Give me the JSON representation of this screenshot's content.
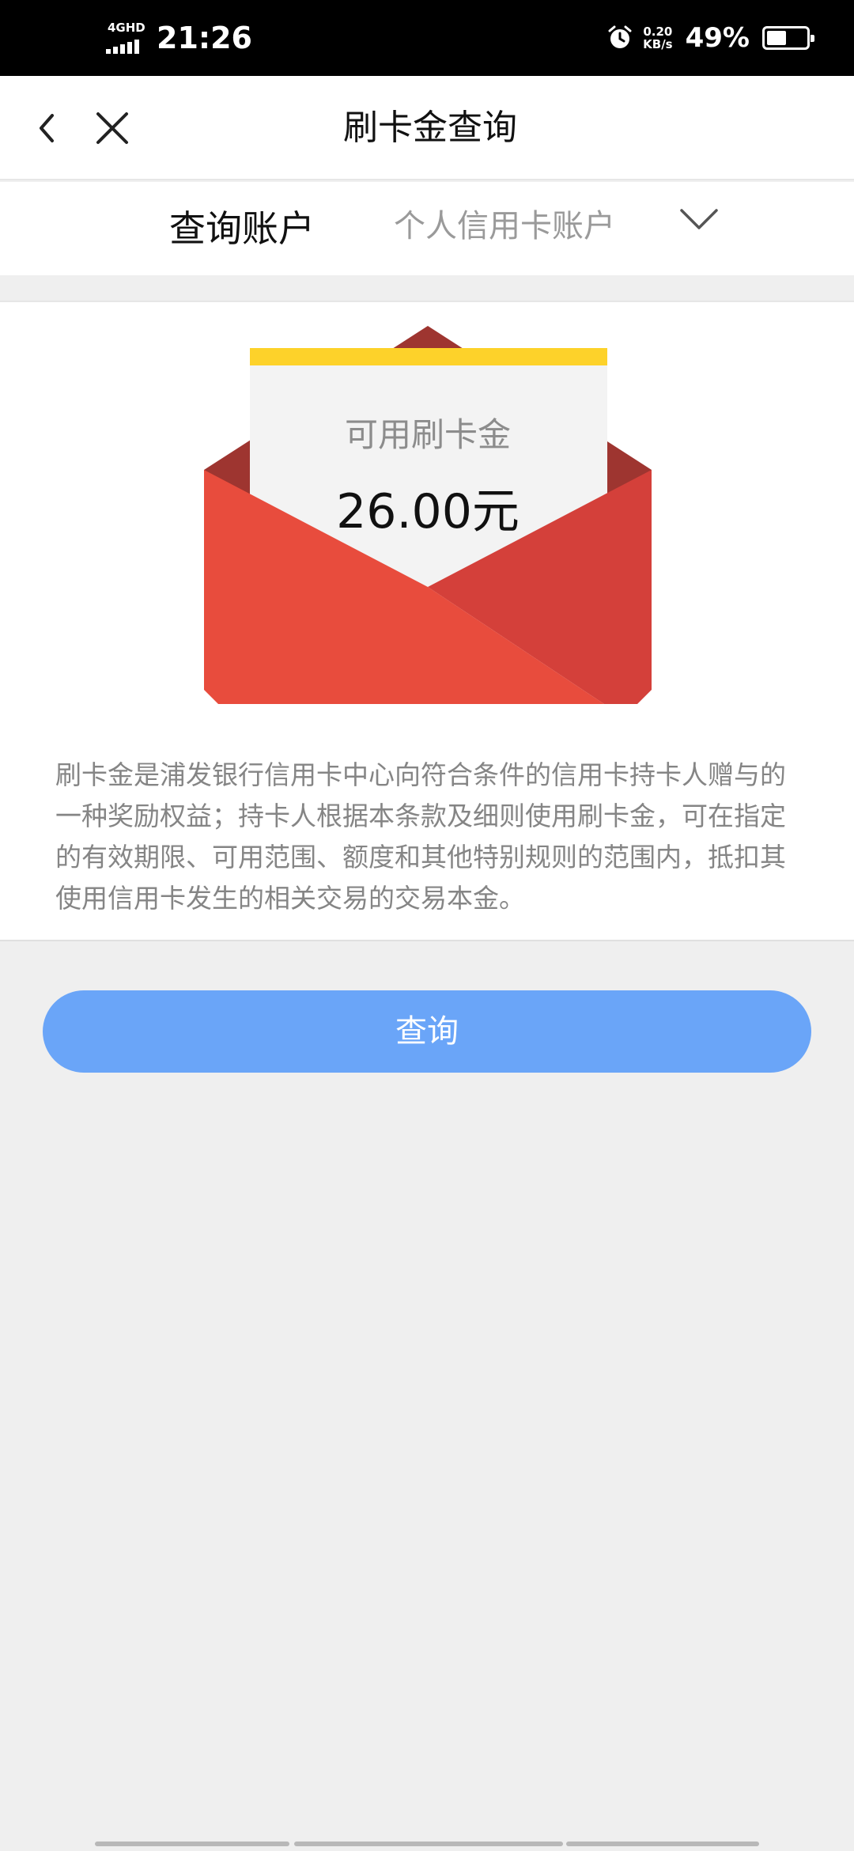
{
  "status_bar": {
    "network": "4GHD",
    "time": "21:26",
    "speed_value": "0.20",
    "speed_unit": "KB/s",
    "battery": "49%",
    "battery_level": 0.49
  },
  "header": {
    "title": "刷卡金查询"
  },
  "account": {
    "label": "查询账户",
    "selected": "个人信用卡账户"
  },
  "envelope": {
    "label": "可用刷卡金",
    "amount": "26.00元"
  },
  "description": "刷卡金是浦发银行信用卡中心向符合条件的信用卡持卡人赠与的一种奖励权益；持卡人根据本条款及细则使用刷卡金，可在指定的有效期限、可用范围、额度和其他特别规则的范围内，抵扣其使用信用卡发生的相关交易的交易本金。",
  "actions": {
    "query_label": "查询"
  },
  "colors": {
    "primary_button": "#6aa5f8",
    "envelope_red": "#e84c3d",
    "envelope_dark": "#9e3530",
    "letter_bar": "#fdd22a"
  }
}
